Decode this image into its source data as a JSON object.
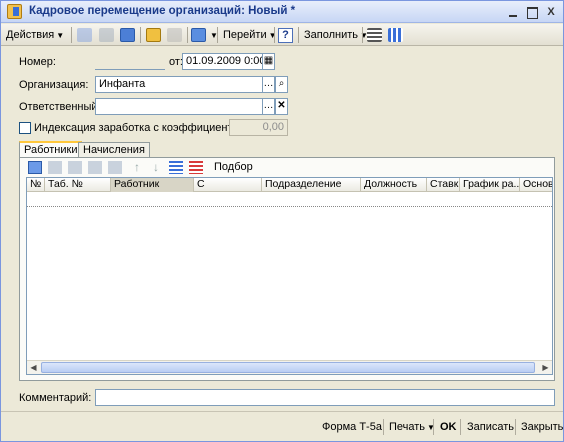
{
  "window": {
    "title": "Кадровое перемещение организаций: Новый *",
    "controls": [
      "minimize-icon",
      "maximize-icon",
      "close-icon"
    ],
    "close_glyph": "X"
  },
  "toolbar": {
    "actions_label": "Действия",
    "goto_label": "Перейти",
    "help_label": "?",
    "fill_label": "Заполнить"
  },
  "form": {
    "number_label": "Номер:",
    "number_value": "",
    "date_label": "от:",
    "date_value": "01.09.2009  0:00:00",
    "organization_label": "Организация:",
    "organization_value": "Инфанта",
    "responsible_label": "Ответственный:",
    "responsible_value": "",
    "indexation_label": "Индексация заработка с коэффициентом:",
    "indexation_checked": false,
    "indexation_value": "0,00",
    "comment_label": "Комментарий:",
    "comment_value": ""
  },
  "tabs": [
    {
      "label": "Работники",
      "active": true
    },
    {
      "label": "Начисления",
      "active": false
    }
  ],
  "subtoolbar": {
    "select_label": "Подбор"
  },
  "grid": {
    "columns": [
      "№",
      "Таб. №",
      "Работник",
      "С",
      "Подразделение",
      "Должность",
      "Ставка",
      "График ра...",
      "Основ"
    ],
    "rows": []
  },
  "bottom": {
    "form_label": "Форма Т-5а",
    "print_label": "Печать",
    "ok_label": "OK",
    "save_label": "Записать",
    "close_label": "Закрыть"
  },
  "colors": {
    "window_bg": "#ece9d8",
    "title_text": "#1a3a8a",
    "field_border": "#7f9db9",
    "active_tab_accent": "#ffc83c"
  }
}
